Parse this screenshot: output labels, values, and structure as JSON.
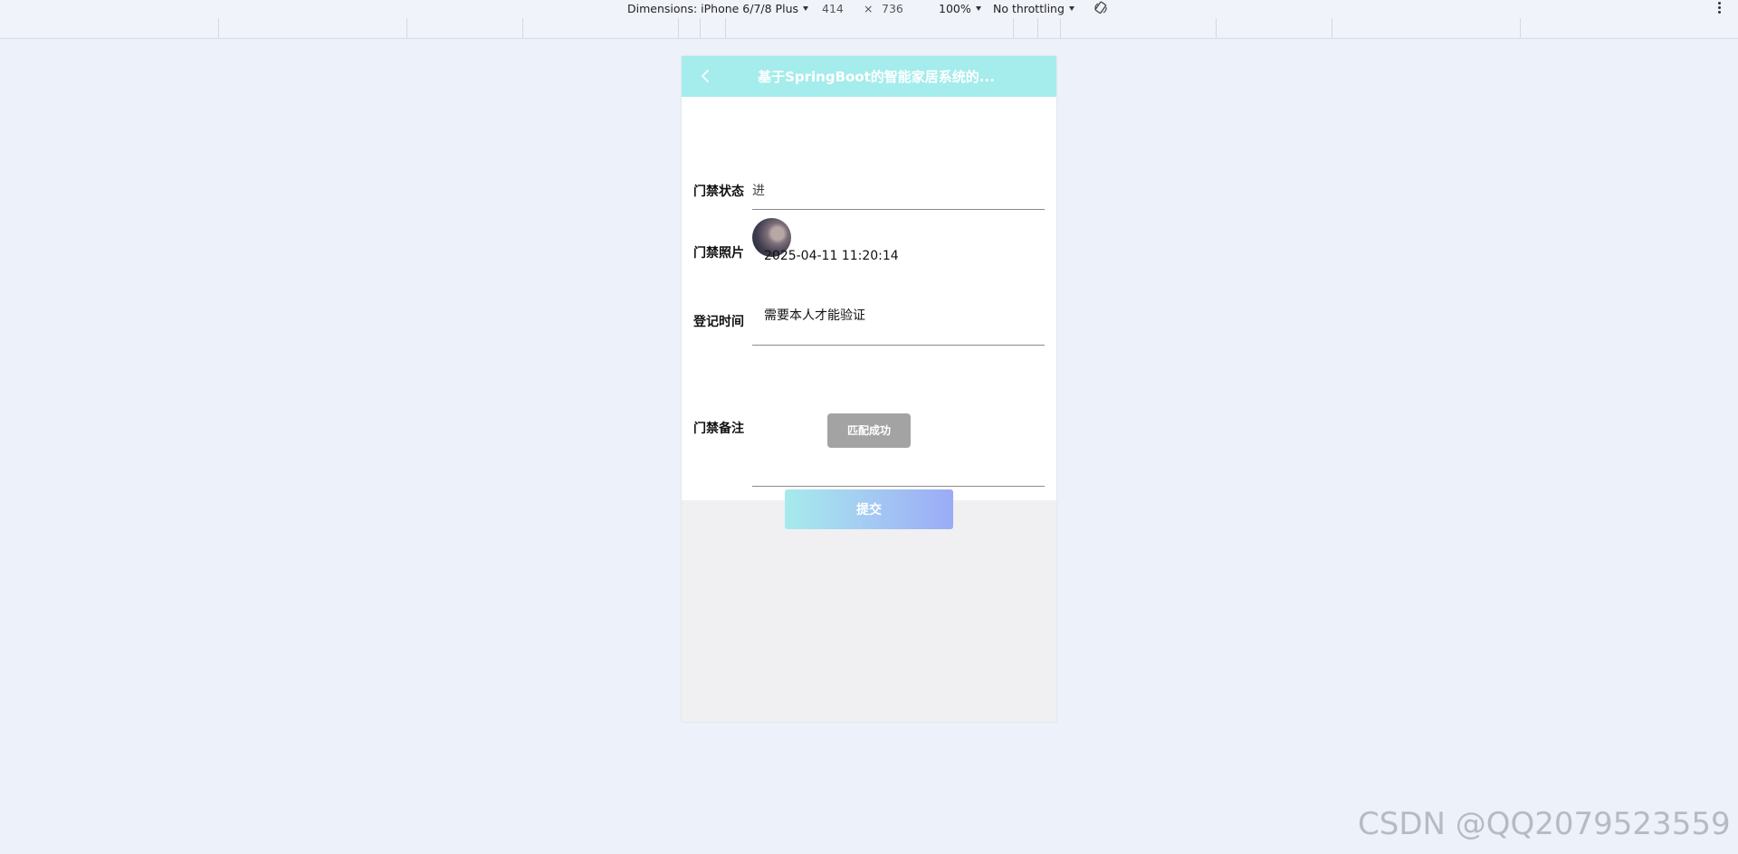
{
  "devtools": {
    "dimensions_label": "Dimensions: iPhone 6/7/8 Plus",
    "width": "414",
    "times": "×",
    "height": "736",
    "zoom": "100%",
    "throttling": "No throttling"
  },
  "app": {
    "title": "基于SpringBoot的智能家居系统的..."
  },
  "form": {
    "status_label": "门禁状态",
    "status_value": "进",
    "photo_label": "门禁照片",
    "time_label": "登记时间",
    "time_value": "2025-04-11 11:20:14",
    "remark_label": "门禁备注",
    "remark_value": "需要本人才能验证",
    "match_button": "匹配成功",
    "submit_button": "提交"
  },
  "watermark": "CSDN @QQ2079523559",
  "colors": {
    "header": "#a5ecec",
    "page_background": "#edf1fa",
    "match_button": "#a3a3a3"
  }
}
